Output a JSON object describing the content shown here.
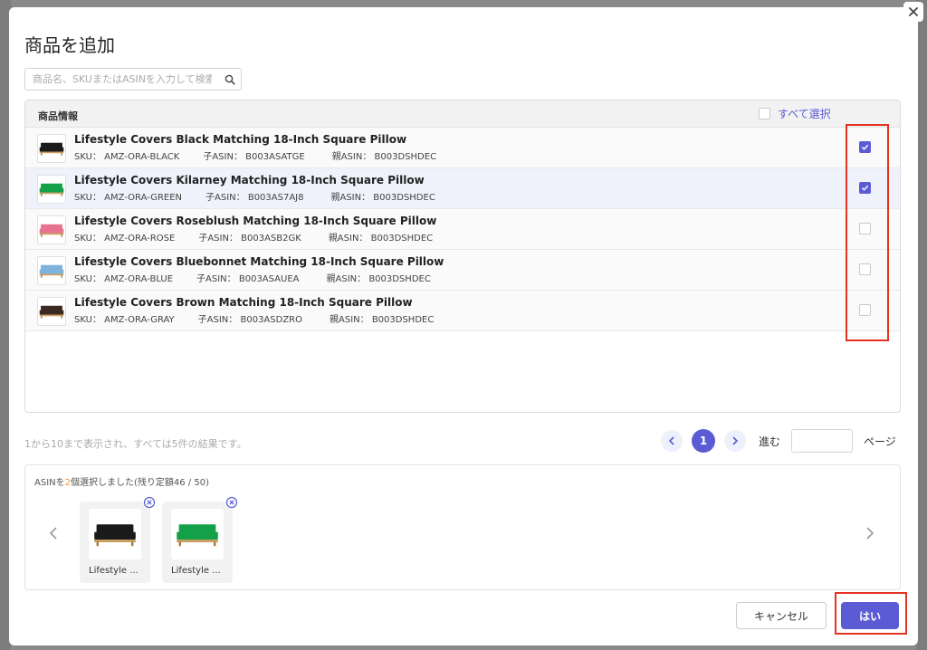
{
  "dialog": {
    "title": "商品を追加",
    "close_icon": "close-icon"
  },
  "search": {
    "placeholder": "商品名、SKUまたはASINを入力して検索",
    "icon": "search-icon"
  },
  "table": {
    "header": "商品情報",
    "select_all_label": "すべて選択",
    "labels": {
      "sku": "SKU：",
      "child_asin": "子ASIN：",
      "parent_asin": "親ASIN："
    },
    "rows": [
      {
        "name": "Lifestyle Covers Black Matching 18-Inch Square Pillow",
        "sku": "AMZ-ORA-BLACK",
        "child_asin": "B003ASATGE",
        "parent_asin": "B003DSHDEC",
        "checked": true,
        "color": "#1a1a1a"
      },
      {
        "name": "Lifestyle Covers Kilarney Matching 18-Inch Square Pillow",
        "sku": "AMZ-ORA-GREEN",
        "child_asin": "B003AS7AJ8",
        "parent_asin": "B003DSHDEC",
        "checked": true,
        "color": "#14a049"
      },
      {
        "name": "Lifestyle Covers Roseblush Matching 18-Inch Square Pillow",
        "sku": "AMZ-ORA-ROSE",
        "child_asin": "B003ASB2GK",
        "parent_asin": "B003DSHDEC",
        "checked": false,
        "color": "#e8738f"
      },
      {
        "name": "Lifestyle Covers Bluebonnet Matching 18-Inch Square Pillow",
        "sku": "AMZ-ORA-BLUE",
        "child_asin": "B003ASAUEA",
        "parent_asin": "B003DSHDEC",
        "checked": false,
        "color": "#7db3dd"
      },
      {
        "name": "Lifestyle Covers Brown Matching 18-Inch Square Pillow",
        "sku": "AMZ-ORA-GRAY",
        "child_asin": "B003ASDZRO",
        "parent_asin": "B003DSHDEC",
        "checked": false,
        "color": "#3b2a22"
      }
    ]
  },
  "pagination": {
    "result_text": "1から10まで表示され、すべては5件の結果です。",
    "current_page": "1",
    "go_label": "進む",
    "page_label": "ページ"
  },
  "selected": {
    "title_prefix": "ASINを",
    "count": "2",
    "title_suffix": "個選択しました(残り定額46 / 50)",
    "items": [
      {
        "label": "Lifestyle ...",
        "color": "#1a1a1a"
      },
      {
        "label": "Lifestyle ...",
        "color": "#14a049"
      }
    ]
  },
  "footer": {
    "cancel_label": "キャンセル",
    "ok_label": "はい"
  },
  "colors": {
    "accent": "#5b5bd6",
    "highlight": "#e53322",
    "count": "#f29c1f"
  }
}
